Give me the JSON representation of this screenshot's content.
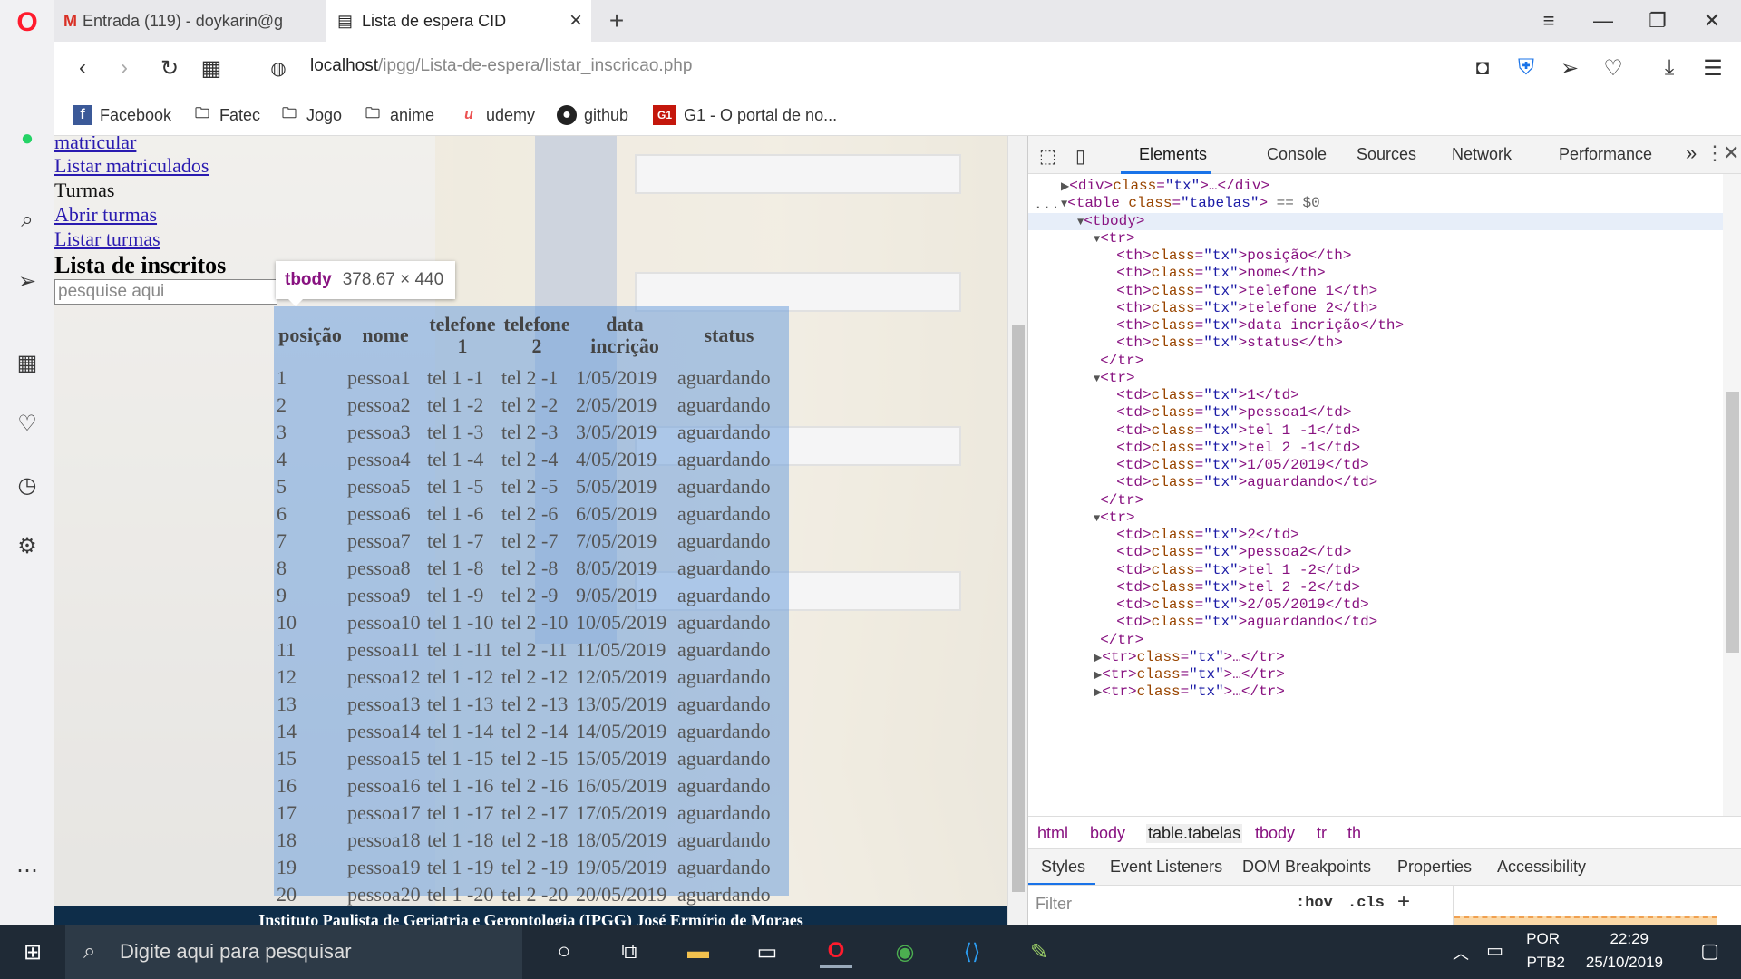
{
  "browser": {
    "tabs": [
      {
        "title": "Entrada (119) - doykarin@g",
        "icon": "gmail-icon",
        "active": false
      },
      {
        "title": "Lista de espera CID",
        "icon": "page-icon",
        "active": true
      }
    ],
    "new_tab": "+",
    "url_host": "localhost",
    "url_path": "/ipgg/Lista-de-espera/listar_inscricao.php",
    "bookmarks": [
      {
        "label": "Facebook",
        "icon": "facebook-icon"
      },
      {
        "label": "Fatec",
        "icon": "folder-icon"
      },
      {
        "label": "Jogo",
        "icon": "folder-icon"
      },
      {
        "label": "anime",
        "icon": "folder-icon"
      },
      {
        "label": "udemy",
        "icon": "udemy-icon"
      },
      {
        "label": "github",
        "icon": "github-icon"
      },
      {
        "label": "G1 - O portal de no...",
        "icon": "g1-icon"
      }
    ]
  },
  "page": {
    "links": [
      "matricular",
      "Listar matriculados"
    ],
    "turmas_label": "Turmas",
    "turmas_links": [
      "Abrir turmas",
      "Listar turmas"
    ],
    "title": "Lista de inscritos",
    "search_placeholder": "pesquise aqui",
    "table_headers": [
      "posição",
      "nome",
      "telefone 1",
      "telefone 2",
      "data incrição",
      "status"
    ],
    "rows": [
      [
        "1",
        "pessoa1",
        "tel 1 -1",
        "tel 2 -1",
        "1/05/2019",
        "aguardando"
      ],
      [
        "2",
        "pessoa2",
        "tel 1 -2",
        "tel 2 -2",
        "2/05/2019",
        "aguardando"
      ],
      [
        "3",
        "pessoa3",
        "tel 1 -3",
        "tel 2 -3",
        "3/05/2019",
        "aguardando"
      ],
      [
        "4",
        "pessoa4",
        "tel 1 -4",
        "tel 2 -4",
        "4/05/2019",
        "aguardando"
      ],
      [
        "5",
        "pessoa5",
        "tel 1 -5",
        "tel 2 -5",
        "5/05/2019",
        "aguardando"
      ],
      [
        "6",
        "pessoa6",
        "tel 1 -6",
        "tel 2 -6",
        "6/05/2019",
        "aguardando"
      ],
      [
        "7",
        "pessoa7",
        "tel 1 -7",
        "tel 2 -7",
        "7/05/2019",
        "aguardando"
      ],
      [
        "8",
        "pessoa8",
        "tel 1 -8",
        "tel 2 -8",
        "8/05/2019",
        "aguardando"
      ],
      [
        "9",
        "pessoa9",
        "tel 1 -9",
        "tel 2 -9",
        "9/05/2019",
        "aguardando"
      ],
      [
        "10",
        "pessoa10",
        "tel 1 -10",
        "tel 2 -10",
        "10/05/2019",
        "aguardando"
      ],
      [
        "11",
        "pessoa11",
        "tel 1 -11",
        "tel 2 -11",
        "11/05/2019",
        "aguardando"
      ],
      [
        "12",
        "pessoa12",
        "tel 1 -12",
        "tel 2 -12",
        "12/05/2019",
        "aguardando"
      ],
      [
        "13",
        "pessoa13",
        "tel 1 -13",
        "tel 2 -13",
        "13/05/2019",
        "aguardando"
      ],
      [
        "14",
        "pessoa14",
        "tel 1 -14",
        "tel 2 -14",
        "14/05/2019",
        "aguardando"
      ],
      [
        "15",
        "pessoa15",
        "tel 1 -15",
        "tel 2 -15",
        "15/05/2019",
        "aguardando"
      ],
      [
        "16",
        "pessoa16",
        "tel 1 -16",
        "tel 2 -16",
        "16/05/2019",
        "aguardando"
      ],
      [
        "17",
        "pessoa17",
        "tel 1 -17",
        "tel 2 -17",
        "17/05/2019",
        "aguardando"
      ],
      [
        "18",
        "pessoa18",
        "tel 1 -18",
        "tel 2 -18",
        "18/05/2019",
        "aguardando"
      ],
      [
        "19",
        "pessoa19",
        "tel 1 -19",
        "tel 2 -19",
        "19/05/2019",
        "aguardando"
      ],
      [
        "20",
        "pessoa20",
        "tel 1 -20",
        "tel 2 -20",
        "20/05/2019",
        "aguardando"
      ]
    ],
    "tooltip_tag": "tbody",
    "tooltip_dims": "378.67 × 440",
    "footer": "Instituto Paulista de Geriatria e Gerontologia (IPGG) José Ermírio de Moraes"
  },
  "devtools": {
    "tabs": [
      "Elements",
      "Console",
      "Sources",
      "Network",
      "Performance"
    ],
    "more": "»",
    "dom_lines": [
      {
        "indent": 0,
        "text": "<div>…</div>",
        "tri": "▶"
      },
      {
        "indent": 0,
        "text": "<table class=\"tabelas\"> == $0",
        "tri": "▼"
      },
      {
        "indent": 1,
        "text": "<tbody>",
        "tri": "▼"
      },
      {
        "indent": 2,
        "text": "<tr>",
        "tri": "▼"
      },
      {
        "indent": 3,
        "text": "<th>posição</th>",
        "tri": ""
      },
      {
        "indent": 3,
        "text": "<th>nome</th>",
        "tri": ""
      },
      {
        "indent": 3,
        "text": "<th>telefone 1</th>",
        "tri": ""
      },
      {
        "indent": 3,
        "text": "<th>telefone 2</th>",
        "tri": ""
      },
      {
        "indent": 3,
        "text": "<th>data incrição</th>",
        "tri": ""
      },
      {
        "indent": 3,
        "text": "<th>status</th>",
        "tri": ""
      },
      {
        "indent": 2,
        "text": "</tr>",
        "tri": ""
      },
      {
        "indent": 2,
        "text": "<tr>",
        "tri": "▼"
      },
      {
        "indent": 3,
        "text": "<td>1</td>",
        "tri": ""
      },
      {
        "indent": 3,
        "text": "<td>pessoa1</td>",
        "tri": ""
      },
      {
        "indent": 3,
        "text": "<td>tel 1 -1</td>",
        "tri": ""
      },
      {
        "indent": 3,
        "text": "<td>tel 2 -1</td>",
        "tri": ""
      },
      {
        "indent": 3,
        "text": "<td>1/05/2019</td>",
        "tri": ""
      },
      {
        "indent": 3,
        "text": "<td>aguardando</td>",
        "tri": ""
      },
      {
        "indent": 2,
        "text": "</tr>",
        "tri": ""
      },
      {
        "indent": 2,
        "text": "<tr>",
        "tri": "▼"
      },
      {
        "indent": 3,
        "text": "<td>2</td>",
        "tri": ""
      },
      {
        "indent": 3,
        "text": "<td>pessoa2</td>",
        "tri": ""
      },
      {
        "indent": 3,
        "text": "<td>tel 1 -2</td>",
        "tri": ""
      },
      {
        "indent": 3,
        "text": "<td>tel 2 -2</td>",
        "tri": ""
      },
      {
        "indent": 3,
        "text": "<td>2/05/2019</td>",
        "tri": ""
      },
      {
        "indent": 3,
        "text": "<td>aguardando</td>",
        "tri": ""
      },
      {
        "indent": 2,
        "text": "</tr>",
        "tri": ""
      },
      {
        "indent": 2,
        "text": "<tr>…</tr>",
        "tri": "▶"
      },
      {
        "indent": 2,
        "text": "<tr>…</tr>",
        "tri": "▶"
      },
      {
        "indent": 2,
        "text": "<tr>…</tr>",
        "tri": "▶"
      }
    ],
    "dom_ellipsis": "...",
    "breadcrumbs": [
      "html",
      "body",
      "table.tabelas",
      "tbody",
      "tr",
      "th"
    ],
    "styles_tabs": [
      "Styles",
      "Event Listeners",
      "DOM Breakpoints",
      "Properties",
      "Accessibility"
    ],
    "filter_placeholder": "Filter",
    "hov": ":hov",
    "cls": ".cls",
    "plus": "+"
  },
  "taskbar": {
    "search_placeholder": "Digite aqui para pesquisar",
    "lang_1": "POR",
    "lang_2": "PTB2",
    "time": "22:29",
    "date": "25/10/2019"
  },
  "colors": {
    "accent": "#1a73e8",
    "opera_red": "#ff1b2d",
    "highlight": "#70a0dc",
    "taskbar": "#1f2a36"
  }
}
